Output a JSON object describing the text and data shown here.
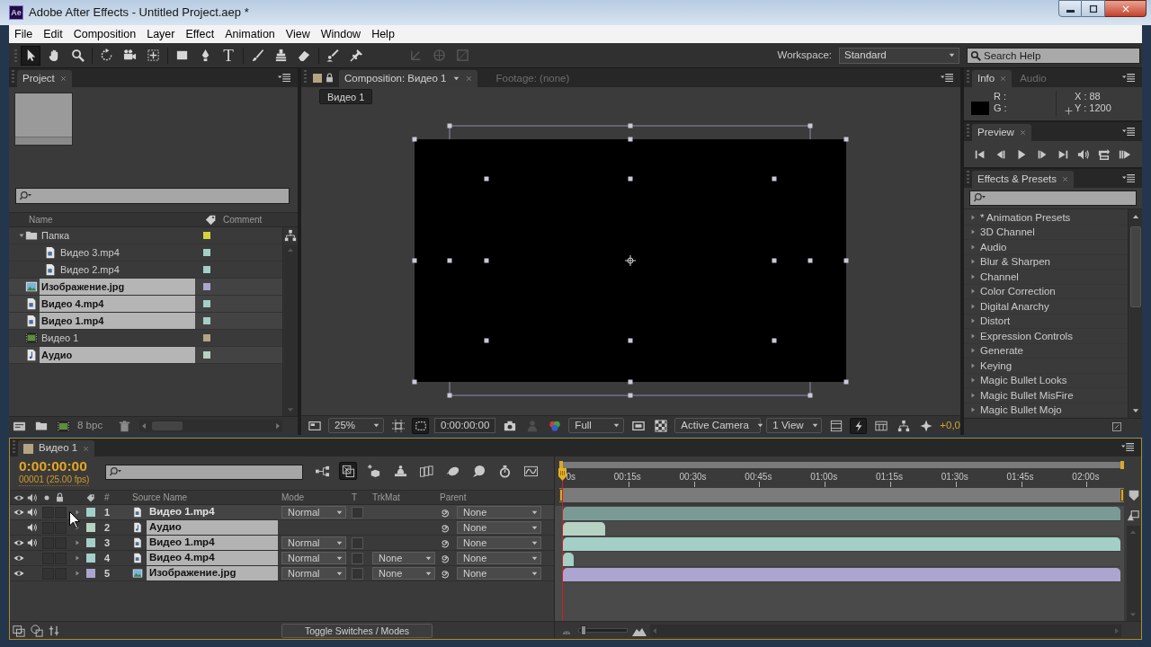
{
  "window": {
    "app_icon": "Ae",
    "title": "Adobe After Effects - Untitled Project.aep *"
  },
  "menu": [
    "File",
    "Edit",
    "Composition",
    "Layer",
    "Effect",
    "Animation",
    "View",
    "Window",
    "Help"
  ],
  "tools": [
    {
      "kind": "selection",
      "selected": true,
      "disabled": false
    },
    {
      "kind": "hand",
      "selected": false,
      "disabled": false
    },
    {
      "kind": "zoom",
      "selected": false,
      "disabled": false
    },
    {
      "kind": "rotate",
      "selected": false,
      "disabled": false
    },
    {
      "kind": "camera",
      "selected": false,
      "disabled": false
    },
    {
      "kind": "pan-behind",
      "selected": false,
      "disabled": false
    },
    {
      "kind": "rectangle",
      "selected": false,
      "disabled": false
    },
    {
      "kind": "pen",
      "selected": false,
      "disabled": false
    },
    {
      "kind": "type",
      "glyph": "T",
      "selected": false,
      "disabled": false
    },
    {
      "kind": "brush",
      "selected": false,
      "disabled": false
    },
    {
      "kind": "clone",
      "selected": false,
      "disabled": false
    },
    {
      "kind": "eraser",
      "selected": false,
      "disabled": false
    },
    {
      "kind": "roto",
      "selected": false,
      "disabled": false
    },
    {
      "kind": "puppet",
      "selected": false,
      "disabled": false
    },
    {
      "kind": "local-axis",
      "selected": false,
      "disabled": true
    },
    {
      "kind": "world-axis",
      "selected": false,
      "disabled": true
    },
    {
      "kind": "view-axis",
      "selected": false,
      "disabled": true
    }
  ],
  "workspace": {
    "label": "Workspace:",
    "value": "Standard"
  },
  "search_help": {
    "placeholder": "Search Help"
  },
  "project": {
    "tab": "Project",
    "columns": [
      "Name",
      "Comment"
    ],
    "items": [
      {
        "kind": "folder",
        "name": "Папка",
        "color": "#d6d23c",
        "selected": false,
        "expanded": true,
        "children": [
          {
            "kind": "video",
            "name": "Видео 3.mp4",
            "color": "#a3cfc6",
            "selected": false
          },
          {
            "kind": "video",
            "name": "Видео 2.mp4",
            "color": "#a3cfc6",
            "selected": false
          }
        ]
      },
      {
        "kind": "image",
        "name": "Изображение.jpg",
        "color": "#aba5cf",
        "selected": true
      },
      {
        "kind": "video",
        "name": "Видео 4.mp4",
        "color": "#a3cfc6",
        "selected": true
      },
      {
        "kind": "video",
        "name": "Видео 1.mp4",
        "color": "#a3cfc6",
        "selected": true
      },
      {
        "kind": "composition",
        "name": "Видео 1",
        "color": "#b3a484",
        "selected": false
      },
      {
        "kind": "audio",
        "name": "Аудио",
        "color": "#b6d2c2",
        "selected": true
      }
    ],
    "bit_depth": "8 bpc"
  },
  "composition": {
    "tabs": [
      {
        "label": "Composition: Видео 1",
        "selected": true,
        "color": "#b3a484"
      },
      {
        "label": "Footage: (none)",
        "selected": false
      }
    ],
    "breadcrumb": "Видео 1",
    "footer": [
      {
        "kind": "preview-toggle",
        "on": false,
        "disabled": false
      },
      {
        "kind": "dropdown",
        "value": "25%"
      },
      {
        "kind": "grid",
        "on": false,
        "disabled": false
      },
      {
        "kind": "mask-toggle",
        "on": true,
        "disabled": false
      },
      {
        "kind": "timecode",
        "value": "0:00:00:00"
      },
      {
        "kind": "snapshot",
        "on": false,
        "disabled": false
      },
      {
        "kind": "show-snapshot",
        "on": false,
        "disabled": true
      },
      {
        "kind": "channels",
        "on": false,
        "disabled": false
      },
      {
        "kind": "dropdown",
        "value": "Full"
      },
      {
        "kind": "region",
        "on": false,
        "disabled": false
      },
      {
        "kind": "transparency",
        "on": false,
        "disabled": false
      },
      {
        "kind": "dropdown",
        "value": "Active Camera"
      },
      {
        "kind": "dropdown",
        "value": "1 View"
      },
      {
        "kind": "pixel-aspect",
        "on": false,
        "disabled": false
      },
      {
        "kind": "fast-preview",
        "on": true,
        "disabled": false
      },
      {
        "kind": "timeline-jump",
        "on": false,
        "disabled": false
      },
      {
        "kind": "flowchart",
        "on": false,
        "disabled": false
      },
      {
        "kind": "exposure",
        "on": false,
        "disabled": false
      },
      {
        "kind": "reading",
        "value": "+0,0"
      }
    ]
  },
  "info": {
    "tabs": [
      {
        "label": "Info",
        "selected": true
      },
      {
        "label": "Audio",
        "selected": false
      }
    ],
    "r": "R :",
    "g": "G :",
    "x": "X : 88",
    "y": "Y : 1200"
  },
  "preview": {
    "tab": "Preview",
    "controls": [
      {
        "kind": "first-frame"
      },
      {
        "kind": "prev-frame"
      },
      {
        "kind": "play"
      },
      {
        "kind": "next-frame"
      },
      {
        "kind": "last-frame"
      },
      {
        "kind": "audio"
      },
      {
        "kind": "loop"
      },
      {
        "kind": "ram-preview"
      }
    ]
  },
  "effects": {
    "tab": "Effects & Presets",
    "categories": [
      {
        "name": "* Animation Presets",
        "expanded": false
      },
      {
        "name": "3D Channel",
        "expanded": false
      },
      {
        "name": "Audio",
        "expanded": false
      },
      {
        "name": "Blur & Sharpen",
        "expanded": false
      },
      {
        "name": "Channel",
        "expanded": false
      },
      {
        "name": "Color Correction",
        "expanded": false
      },
      {
        "name": "Digital Anarchy",
        "expanded": false
      },
      {
        "name": "Distort",
        "expanded": false
      },
      {
        "name": "Expression Controls",
        "expanded": false
      },
      {
        "name": "Generate",
        "expanded": false
      },
      {
        "name": "Keying",
        "expanded": false
      },
      {
        "name": "Magic Bullet Looks",
        "expanded": false
      },
      {
        "name": "Magic Bullet MisFire",
        "expanded": false
      },
      {
        "name": "Magic Bullet Mojo",
        "expanded": false
      }
    ]
  },
  "timeline": {
    "tab": {
      "label": "Видео 1",
      "color": "#b3a484"
    },
    "timecode": "0:00:00:00",
    "frame": "00001 (25.00 fps)",
    "switches": [
      {
        "kind": "mini-flowchart",
        "on": false
      },
      {
        "kind": "live-update",
        "on": true
      },
      {
        "kind": "draft-3d",
        "on": false
      },
      {
        "kind": "shy",
        "on": false
      },
      {
        "kind": "frame-blending",
        "on": false
      },
      {
        "kind": "motion-blur",
        "on": false
      },
      {
        "kind": "brainstorm",
        "on": false
      },
      {
        "kind": "auto-keyframe",
        "on": false
      },
      {
        "kind": "graph-editor",
        "on": false
      }
    ],
    "columns": [
      "#",
      "Source Name",
      "Mode",
      "T",
      "TrkMat",
      "Parent"
    ],
    "ruler": [
      "0s",
      "00:15s",
      "00:30s",
      "00:45s",
      "01:00s",
      "01:15s",
      "01:30s",
      "01:45s",
      "02:00s"
    ],
    "layers": [
      {
        "number": "1",
        "name": "Видео 1.mp4",
        "kind": "video",
        "color": "#a3cfc6",
        "selected": false,
        "video": true,
        "audio": true,
        "solo": false,
        "locked": false,
        "expanded": false,
        "mode": "Normal",
        "preserve_transparency": false,
        "parent": "None",
        "level": 1
      },
      {
        "number": "2",
        "name": "Аудио",
        "kind": "audio",
        "color": "#b6d2c2",
        "selected": true,
        "video": false,
        "audio": true,
        "solo": false,
        "locked": false,
        "expanded": false,
        "parent": "None",
        "level": 0.075
      },
      {
        "number": "3",
        "name": "Видео 1.mp4",
        "kind": "video",
        "color": "#a3cfc6",
        "selected": true,
        "video": true,
        "audio": true,
        "solo": false,
        "locked": false,
        "expanded": false,
        "mode": "Normal",
        "preserve_transparency": false,
        "parent": "None",
        "level": 1
      },
      {
        "number": "4",
        "name": "Видео 4.mp4",
        "kind": "video",
        "color": "#a3cfc6",
        "selected": true,
        "video": true,
        "audio": false,
        "solo": false,
        "locked": false,
        "expanded": false,
        "mode": "Normal",
        "preserve_transparency": false,
        "track_matte": "None",
        "parent": "None",
        "level": 0.02
      },
      {
        "number": "5",
        "name": "Изображение.jpg",
        "kind": "image",
        "color": "#aba5cf",
        "selected": true,
        "video": true,
        "audio": false,
        "solo": false,
        "locked": false,
        "expanded": false,
        "mode": "Normal",
        "preserve_transparency": false,
        "track_matte": "None",
        "parent": "None",
        "level": 1
      }
    ],
    "toggle_button": "Toggle Switches / Modes",
    "zoom_slider": {
      "level": 0.05
    }
  }
}
